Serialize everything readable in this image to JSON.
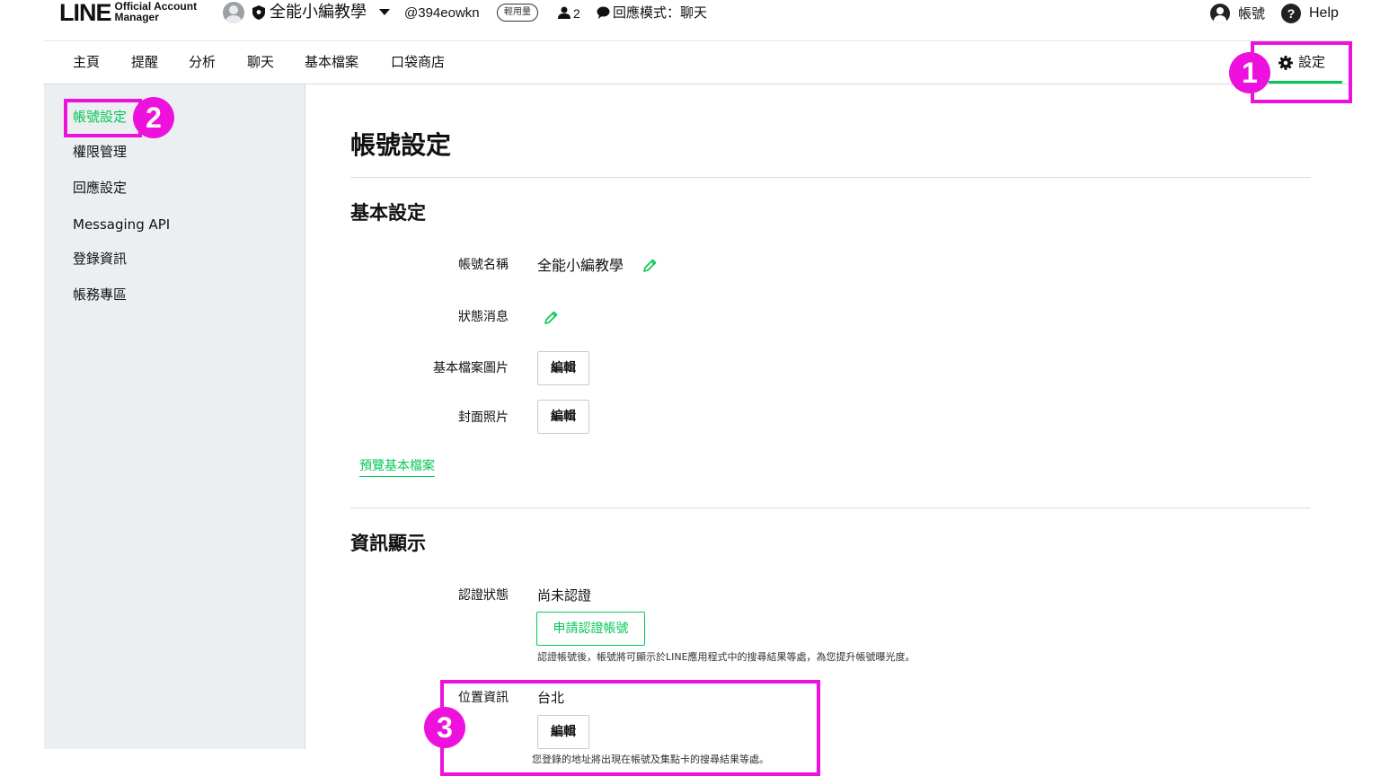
{
  "topbar": {
    "logo_main": "LINE",
    "logo_sub_1": "Official Account",
    "logo_sub_2": "Manager",
    "account_name": "全能小編教學",
    "account_id": "@394eowkn",
    "plan_badge": "輕用量",
    "members_count": "2",
    "reply_mode": "回應模式：聊天",
    "account_label": "帳號",
    "help_icon_glyph": "?",
    "help_label": "Help"
  },
  "nav": {
    "tabs": [
      "主頁",
      "提醒",
      "分析",
      "聊天",
      "基本檔案",
      "口袋商店"
    ],
    "settings_label": "設定"
  },
  "sidebar": {
    "items": [
      "帳號設定",
      "權限管理",
      "回應設定",
      "Messaging API",
      "登錄資訊",
      "帳務專區"
    ],
    "active_index": 0
  },
  "main": {
    "page_title": "帳號設定",
    "basic": {
      "title": "基本設定",
      "account_name_label": "帳號名稱",
      "account_name_value": "全能小編教學",
      "status_label": "狀態消息",
      "profile_image_label": "基本檔案圖片",
      "cover_photo_label": "封面照片",
      "edit_label": "編輯",
      "preview_link": "預覽基本檔案"
    },
    "info": {
      "title": "資訊顯示",
      "verify_label": "認證狀態",
      "verify_value": "尚未認證",
      "apply_button": "申請認證帳號",
      "verify_note": "認證帳號後，帳號將可顯示於LINE應用程式中的搜尋結果等處，為您提升帳號曝光度。",
      "location_label": "位置資訊",
      "location_value": "台北",
      "location_note": "您登錄的地址將出現在帳號及集點卡的搜尋結果等處。"
    }
  },
  "annotations": {
    "badge_1": "1",
    "badge_2": "2",
    "badge_3": "3",
    "color": "#ee11dd"
  },
  "colors": {
    "accent_green": "#06c755",
    "sidebar_bg": "#eceff1"
  },
  "icons": [
    "account-avatar",
    "shield-icon",
    "caret-down-icon",
    "members-icon",
    "chat-icon",
    "account-icon",
    "help-icon",
    "gear-icon",
    "pencil-icon"
  ]
}
